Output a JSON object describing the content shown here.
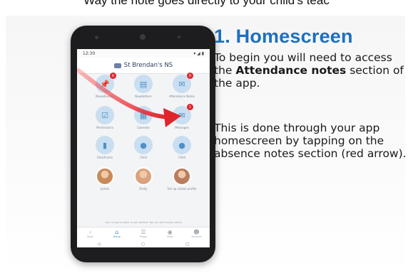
{
  "caption": {
    "top_text": "Way the note goes directly to your child's teac"
  },
  "phone": {
    "status_time": "12:30",
    "status_icons": "▾ ◢ ▮",
    "school_name": "St Brendan's NS",
    "tiles": [
      {
        "id": "news",
        "label": "News/Events",
        "icon": "pin-icon",
        "glyph": "📌",
        "badge": "6"
      },
      {
        "id": "newsletters",
        "label": "Newsletters",
        "icon": "newsletter-icon",
        "glyph": "▤",
        "badge": ""
      },
      {
        "id": "attendance",
        "label": "Attendance Notes",
        "icon": "attendance-notes-icon",
        "glyph": "✉",
        "badge": "0"
      },
      {
        "id": "permissions",
        "label": "Permissions",
        "icon": "checkbox-icon",
        "glyph": "☑",
        "badge": ""
      },
      {
        "id": "calendar",
        "label": "Calendar",
        "icon": "calendar-icon",
        "glyph": "▦",
        "badge": ""
      },
      {
        "id": "messages",
        "label": "Messages",
        "icon": "messages-icon",
        "glyph": "✉",
        "badge": "1"
      },
      {
        "id": "files",
        "label": "Files/Forms",
        "icon": "bookmark-icon",
        "glyph": "▮",
        "badge": ""
      },
      {
        "id": "child1",
        "label": "Child",
        "icon": "person-icon",
        "glyph": "●",
        "badge": ""
      },
      {
        "id": "child2",
        "label": "Child",
        "icon": "person-icon",
        "glyph": "●",
        "badge": ""
      },
      {
        "id": "child3",
        "label": "James",
        "icon": "photo",
        "glyph": "",
        "badge": "",
        "photo": "#c98a5a"
      },
      {
        "id": "child4",
        "label": "Emily",
        "icon": "photo",
        "glyph": "",
        "badge": "",
        "photo": "#d9a380"
      },
      {
        "id": "child5",
        "label": "Set up school profile",
        "icon": "photo",
        "glyph": "",
        "badge": "",
        "photo": "#b87d5e"
      }
    ],
    "notice": "Your school number is not verified. You can still receive alerts",
    "nav": [
      {
        "label": "Back",
        "icon": "back-icon",
        "glyph": "‹",
        "active": false
      },
      {
        "label": "Home",
        "icon": "home-icon",
        "glyph": "⌂",
        "active": true
      },
      {
        "label": "Phone",
        "icon": "phone-icon",
        "glyph": "☰",
        "active": false
      },
      {
        "label": "View",
        "icon": "eye-icon",
        "glyph": "◉",
        "active": false
      },
      {
        "label": "Account",
        "icon": "account-icon",
        "glyph": "☻",
        "active": false
      }
    ]
  },
  "info": {
    "heading": "1. Homescreen",
    "para1_before": "To begin you will need to access the ",
    "para1_bold": "Attendance notes",
    "para1_after": " section of the app.",
    "para2": "This is done through your app homescreen by tapping on the absence notes section (red arrow)."
  },
  "colors": {
    "heading": "#1e6fbf",
    "arrow": "#e0242b",
    "tile": "#c9def0",
    "badge": "#e0242b"
  }
}
